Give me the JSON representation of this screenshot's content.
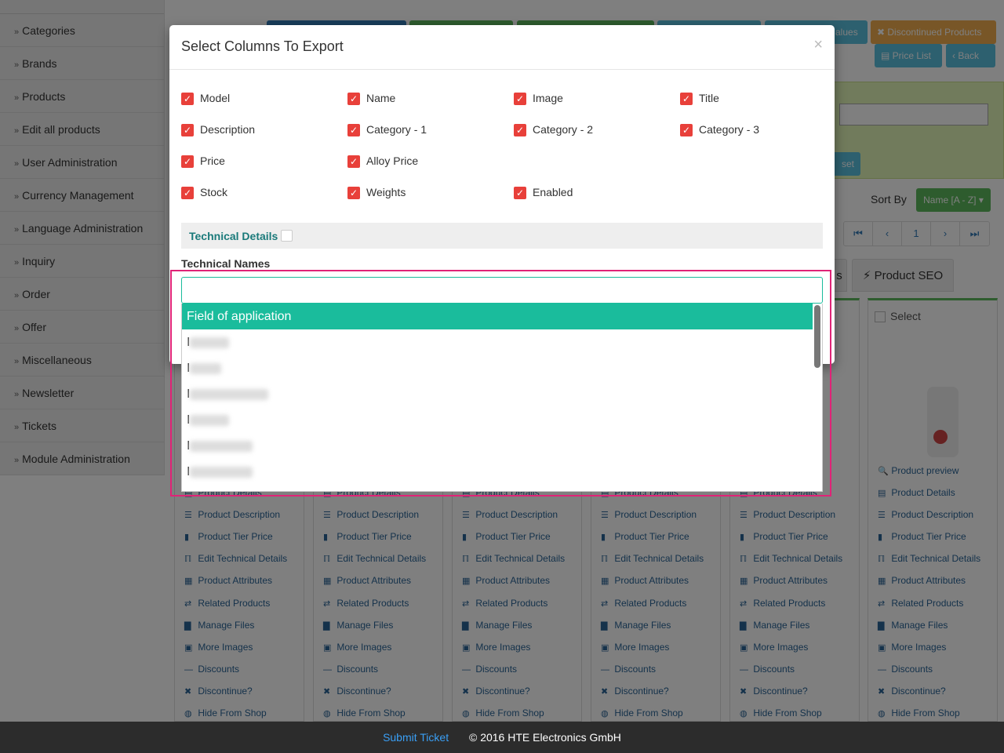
{
  "sidebar": {
    "items": [
      {
        "label": "Categories"
      },
      {
        "label": "Brands"
      },
      {
        "label": "Products"
      },
      {
        "label": "Edit all products"
      },
      {
        "label": "User Administration"
      },
      {
        "label": "Currency Management"
      },
      {
        "label": "Language Administration"
      },
      {
        "label": "Inquiry"
      },
      {
        "label": "Order"
      },
      {
        "label": "Offer"
      },
      {
        "label": "Miscellaneous"
      },
      {
        "label": "Newsletter"
      },
      {
        "label": "Tickets"
      },
      {
        "label": "Module Administration"
      }
    ]
  },
  "toolbar": {
    "values_label": "alues",
    "discontinued_label": "Discontinued Products",
    "price_list_label": "Price List",
    "back_label": "Back",
    "reset_label": "set"
  },
  "sort": {
    "label": "Sort By",
    "value": "Name [A - Z]"
  },
  "pager": {
    "current_page": "1"
  },
  "tabs": {
    "seo_label": "Product SEO",
    "partial_label": "s"
  },
  "product_column": {
    "select_label": "Select",
    "links": [
      {
        "icon": "search-icon",
        "label": "Product preview"
      },
      {
        "icon": "list-icon",
        "label": "Product Details"
      },
      {
        "icon": "align-left-icon",
        "label": "Product Description"
      },
      {
        "icon": "bar-chart-icon",
        "label": "Product Tier Price"
      },
      {
        "icon": "cutlery-icon",
        "label": "Edit Technical Details"
      },
      {
        "icon": "grid-icon",
        "label": "Product Attributes"
      },
      {
        "icon": "retweet-icon",
        "label": "Related Products"
      },
      {
        "icon": "file-icon",
        "label": "Manage Files"
      },
      {
        "icon": "picture-icon",
        "label": "More Images"
      },
      {
        "icon": "minus-icon",
        "label": "Discounts"
      },
      {
        "icon": "remove-icon",
        "label": "Discontinue?"
      },
      {
        "icon": "eye-slash-icon",
        "label": "Hide From Shop"
      }
    ]
  },
  "modal": {
    "title": "Select Columns To Export",
    "close_glyph": "×",
    "columns": [
      {
        "label": "Model",
        "checked": true
      },
      {
        "label": "Name",
        "checked": true
      },
      {
        "label": "Image",
        "checked": true
      },
      {
        "label": "Title",
        "checked": true
      },
      {
        "label": "Description",
        "checked": true
      },
      {
        "label": "Category - 1",
        "checked": true
      },
      {
        "label": "Category - 2",
        "checked": true
      },
      {
        "label": "Category - 3",
        "checked": true
      },
      {
        "label": "Price",
        "checked": true
      },
      {
        "label": "Alloy Price",
        "checked": true
      },
      {
        "label": "Stock",
        "checked": true
      },
      {
        "label": "Weights",
        "checked": true
      },
      {
        "label": "Enabled",
        "checked": true
      }
    ],
    "technical_details_label": "Technical Details",
    "technical_details_checked": false,
    "technical_names_label": "Technical Names",
    "search_value": "",
    "dropdown_options": [
      {
        "label": "Field of application",
        "highlighted": true
      },
      {
        "label": "I",
        "highlighted": false
      },
      {
        "label": "I",
        "highlighted": false
      },
      {
        "label": "I",
        "highlighted": false
      },
      {
        "label": "I",
        "highlighted": false
      },
      {
        "label": "I",
        "highlighted": false
      },
      {
        "label": "I",
        "highlighted": false
      }
    ]
  },
  "footer": {
    "submit_ticket": "Submit Ticket",
    "copyright": "© 2016 HTE Electronics GmbH"
  },
  "colors": {
    "checkbox_red": "#e8403a",
    "dropdown_highlight": "#1abc9c",
    "annotation_border": "#e02377",
    "footer_bg": "#2c2c2c"
  }
}
